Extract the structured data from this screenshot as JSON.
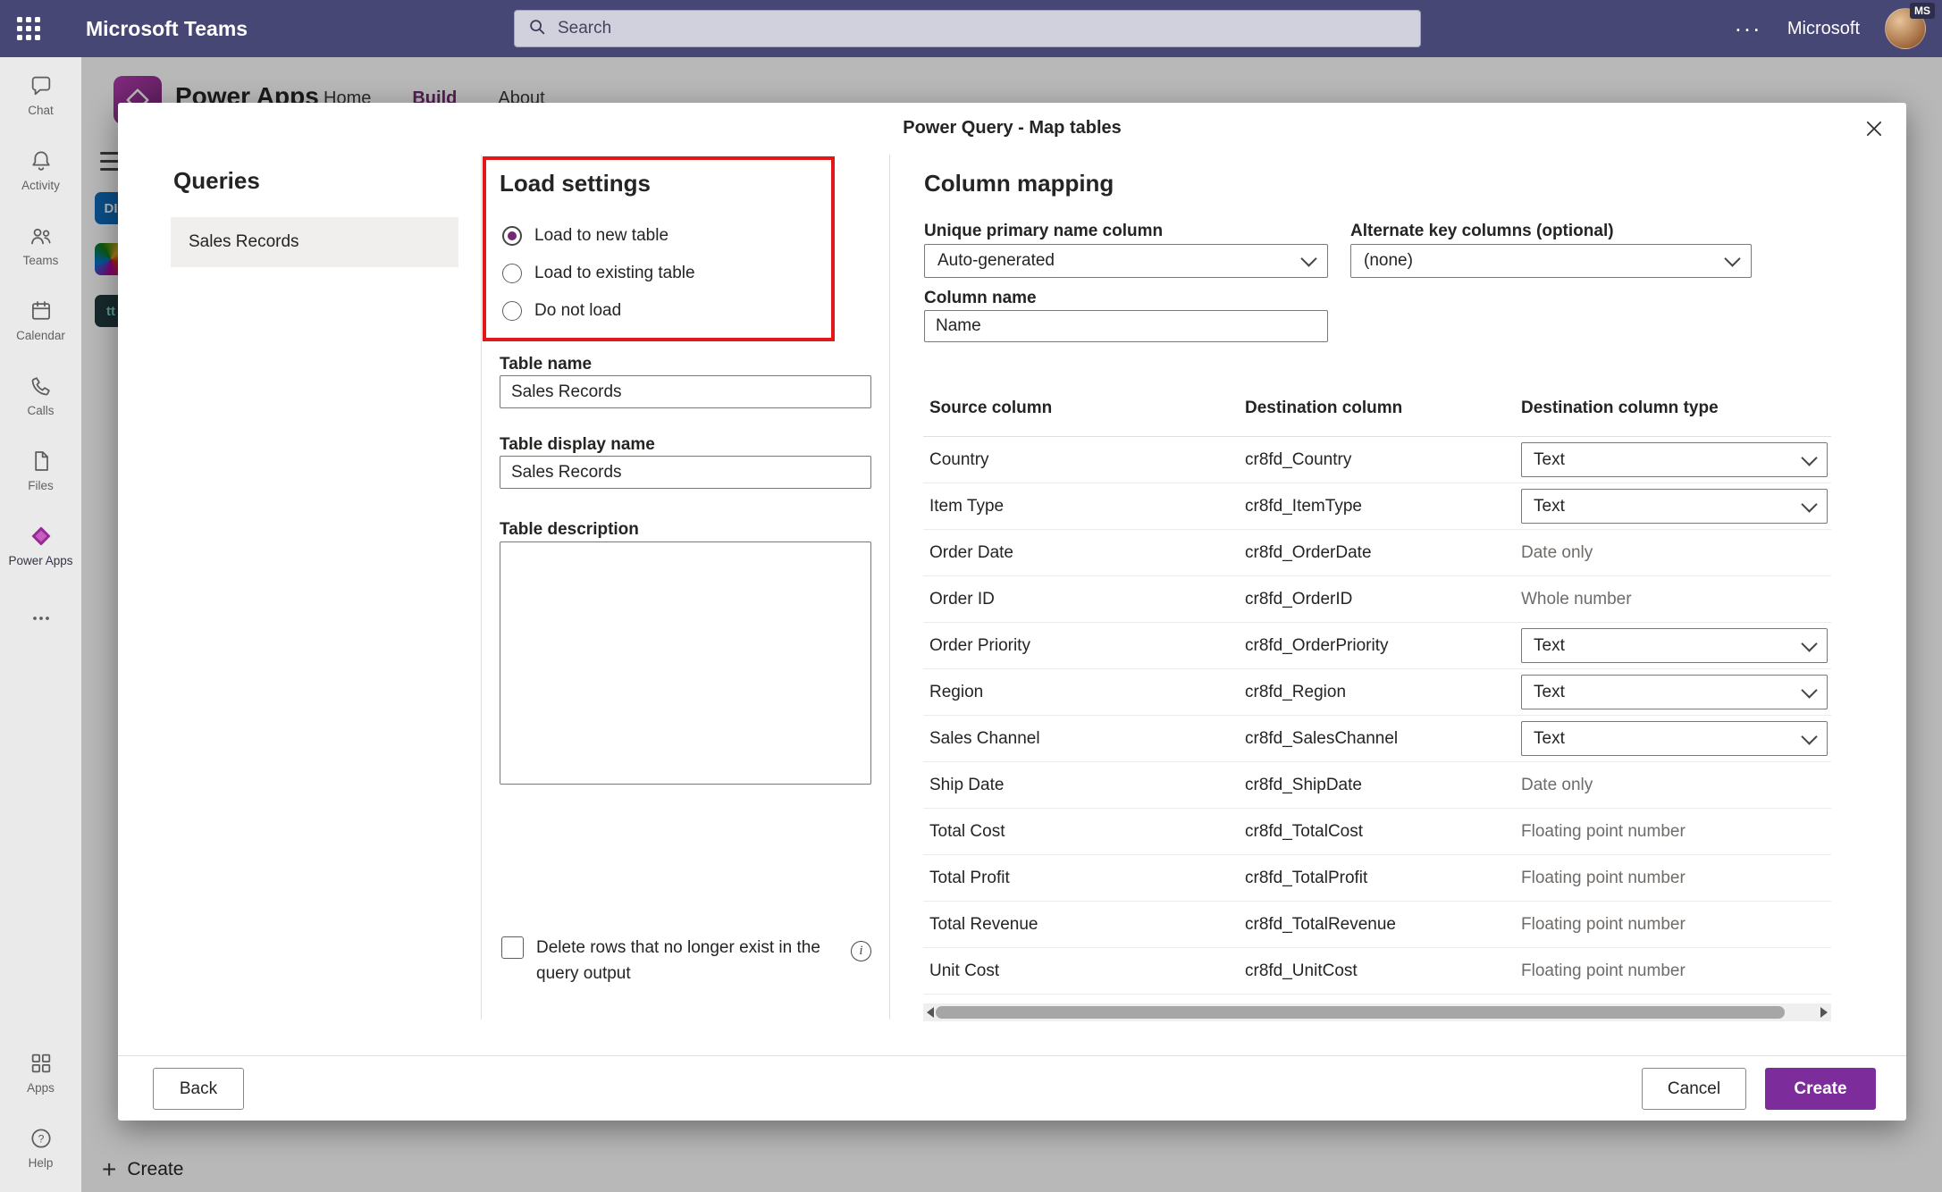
{
  "topbar": {
    "title": "Microsoft Teams",
    "search_placeholder": "Search",
    "more": "...",
    "account": "Microsoft",
    "avatar_initials": "MS"
  },
  "rail": {
    "items": [
      {
        "name": "chat",
        "label": "Chat"
      },
      {
        "name": "activity",
        "label": "Activity"
      },
      {
        "name": "teams",
        "label": "Teams"
      },
      {
        "name": "calendar",
        "label": "Calendar"
      },
      {
        "name": "calls",
        "label": "Calls"
      },
      {
        "name": "files",
        "label": "Files"
      },
      {
        "name": "power-apps",
        "label": "Power Apps",
        "active": true
      },
      {
        "name": "more",
        "label": ""
      }
    ],
    "bottom": [
      {
        "name": "apps",
        "label": "Apps"
      },
      {
        "name": "help",
        "label": "Help"
      }
    ]
  },
  "background": {
    "app": "Power Apps",
    "nav": [
      {
        "label": "Home",
        "active": false
      },
      {
        "label": "Build",
        "active": true
      },
      {
        "label": "About",
        "active": false
      }
    ],
    "badge1": "DI",
    "badge2": "tt",
    "create": "Create"
  },
  "dialog": {
    "title": "Power Query - Map tables",
    "queries": {
      "heading": "Queries",
      "items": [
        "Sales Records"
      ],
      "selected": "Sales Records"
    },
    "load_settings": {
      "heading": "Load settings",
      "options": [
        {
          "label": "Load to new table",
          "selected": true
        },
        {
          "label": "Load to existing table",
          "selected": false
        },
        {
          "label": "Do not load",
          "selected": false
        }
      ],
      "table_name_label": "Table name",
      "table_name_value": "Sales Records",
      "display_name_label": "Table display name",
      "display_name_value": "Sales Records",
      "description_label": "Table description",
      "description_value": "",
      "delete_rows_label": "Delete rows that no longer exist in the query output"
    },
    "column_mapping": {
      "heading": "Column mapping",
      "primary_label": "Unique primary name column",
      "primary_value": "Auto-generated",
      "alternate_label": "Alternate key columns (optional)",
      "alternate_value": "(none)",
      "column_name_label": "Column name",
      "column_name_value": "Name",
      "table": {
        "headers": [
          "Source column",
          "Destination column",
          "Destination column type"
        ],
        "rows": [
          {
            "source": "Country",
            "destination": "cr8fd_Country",
            "type": "Text",
            "editable": true
          },
          {
            "source": "Item Type",
            "destination": "cr8fd_ItemType",
            "type": "Text",
            "editable": true
          },
          {
            "source": "Order Date",
            "destination": "cr8fd_OrderDate",
            "type": "Date only",
            "editable": false
          },
          {
            "source": "Order ID",
            "destination": "cr8fd_OrderID",
            "type": "Whole number",
            "editable": false
          },
          {
            "source": "Order Priority",
            "destination": "cr8fd_OrderPriority",
            "type": "Text",
            "editable": true
          },
          {
            "source": "Region",
            "destination": "cr8fd_Region",
            "type": "Text",
            "editable": true
          },
          {
            "source": "Sales Channel",
            "destination": "cr8fd_SalesChannel",
            "type": "Text",
            "editable": true
          },
          {
            "source": "Ship Date",
            "destination": "cr8fd_ShipDate",
            "type": "Date only",
            "editable": false
          },
          {
            "source": "Total Cost",
            "destination": "cr8fd_TotalCost",
            "type": "Floating point number",
            "editable": false
          },
          {
            "source": "Total Profit",
            "destination": "cr8fd_TotalProfit",
            "type": "Floating point number",
            "editable": false
          },
          {
            "source": "Total Revenue",
            "destination": "cr8fd_TotalRevenue",
            "type": "Floating point number",
            "editable": false
          },
          {
            "source": "Unit Cost",
            "destination": "cr8fd_UnitCost",
            "type": "Floating point number",
            "editable": false
          }
        ]
      }
    },
    "footer": {
      "back": "Back",
      "cancel": "Cancel",
      "create": "Create"
    }
  },
  "colors": {
    "topbar": "#464775",
    "accent": "#742774",
    "create_button": "#7d2c9c",
    "annotation_box": "#e31717",
    "selected_radio_dot": "#742774"
  }
}
